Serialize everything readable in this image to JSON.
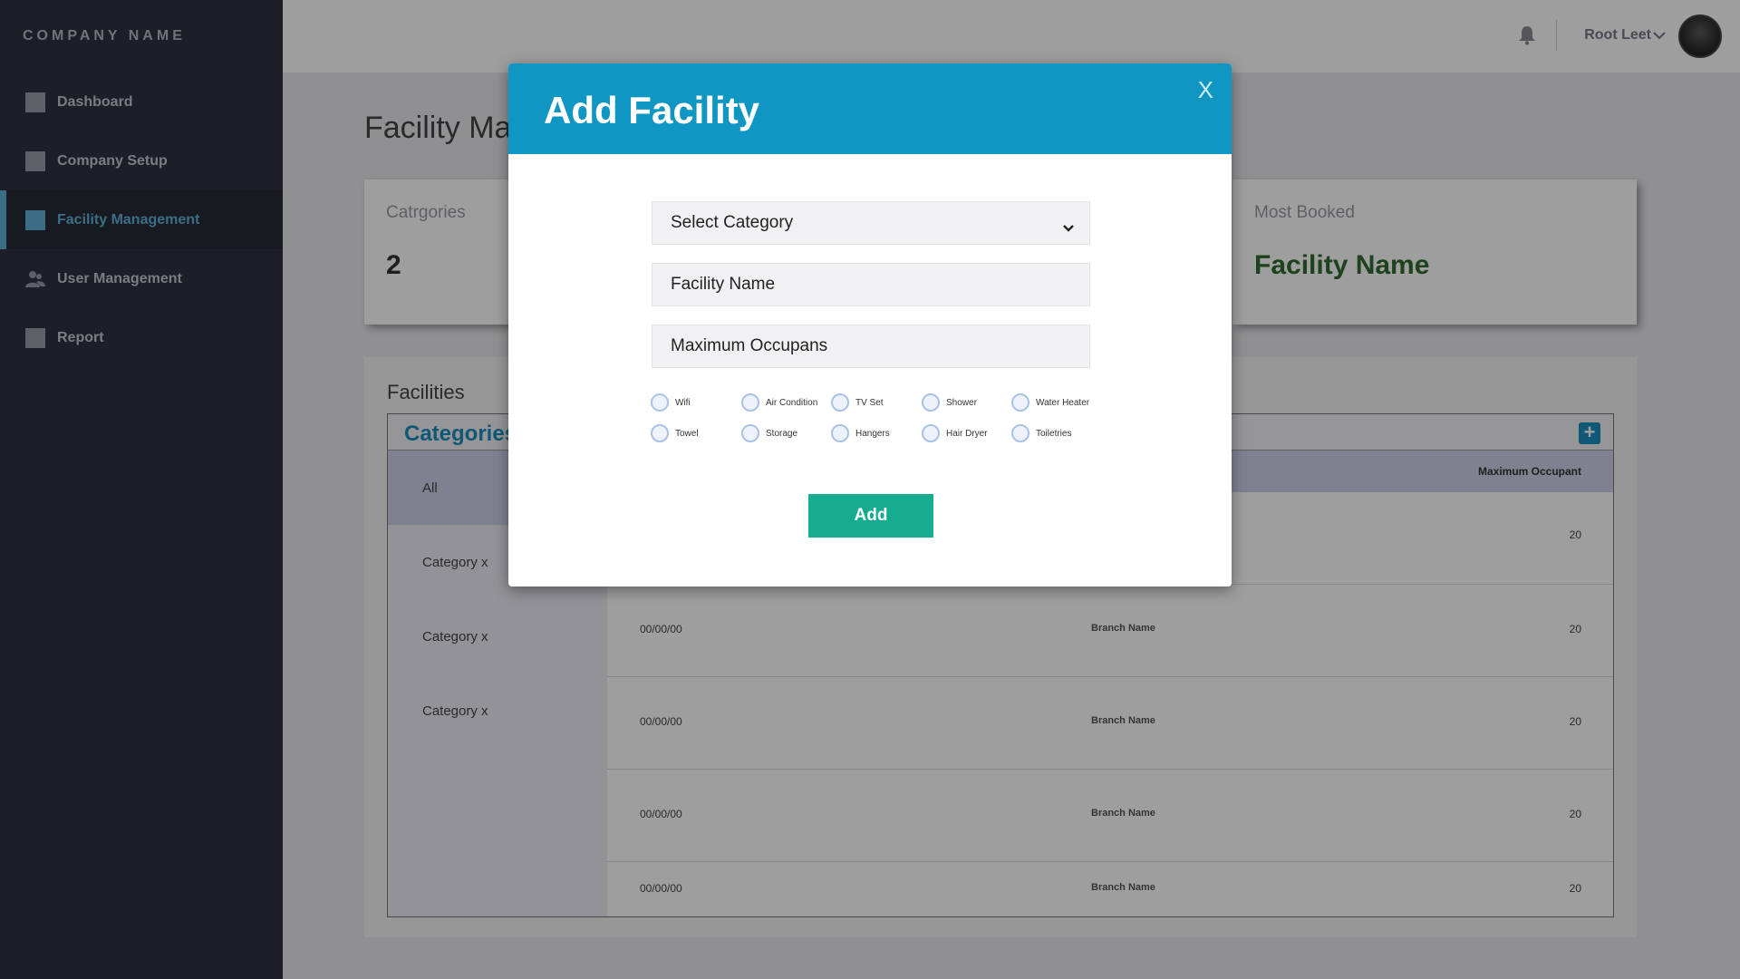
{
  "app": {
    "brand": "COMPANY NAME"
  },
  "sidebar": {
    "items": [
      {
        "label": "Dashboard",
        "icon": "square-icon"
      },
      {
        "label": "Company Setup",
        "icon": "square-icon"
      },
      {
        "label": "Facility Management",
        "icon": "square-icon",
        "active": true
      },
      {
        "label": "User Management",
        "icon": "users-icon"
      },
      {
        "label": "Report",
        "icon": "square-icon"
      }
    ]
  },
  "topbar": {
    "username": "Root Leet",
    "icons": [
      "bell-icon",
      "chevron-down-icon",
      "avatar"
    ]
  },
  "main": {
    "page_title": "Facility Management",
    "stats": [
      {
        "label": "Catrgories",
        "value": "2"
      },
      {
        "label": "Most Booked",
        "value": "Facility Name"
      }
    ],
    "facilities": {
      "title": "Facilities",
      "categories_title": "Categories",
      "categories": [
        "All",
        "Category x",
        "Category x",
        "Category x"
      ],
      "column_max": "Maximum Occupant",
      "rows": [
        {
          "date": "",
          "branch": "",
          "max": "20"
        },
        {
          "date": "00/00/00",
          "branch": "Branch Name",
          "max": "20"
        },
        {
          "date": "00/00/00",
          "branch": "Branch Name",
          "max": "20"
        },
        {
          "date": "00/00/00",
          "branch": "Branch Name",
          "max": "20"
        },
        {
          "date": "00/00/00",
          "branch": "Branch Name",
          "max": "20"
        }
      ]
    }
  },
  "modal": {
    "title": "Add Facility",
    "close": "X",
    "select_category": "Select Category",
    "facility_name_placeholder": "Facility Name",
    "max_occupants_placeholder": "Maximum Occupans",
    "amenities": [
      "Wifi",
      "Air Condition",
      "TV Set",
      "Shower",
      "Water Heater",
      "Towel",
      "Storage",
      "Hangers",
      "Hair Dryer",
      "Toiletries"
    ],
    "add_label": "Add"
  },
  "colors": {
    "accent": "#0f96c2",
    "add_button": "#15ac90",
    "sidebar_bg": "#2f3140",
    "most_booked_value": "#2f6b2f"
  }
}
